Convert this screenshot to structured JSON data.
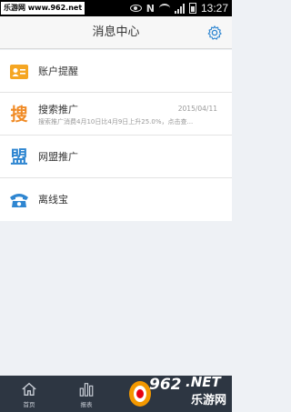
{
  "status_bar": {
    "watermark": "乐游网 www.962.net",
    "network_letter": "N",
    "time": "13:27"
  },
  "header": {
    "title": "消息中心"
  },
  "list": {
    "items": [
      {
        "title": "账户提醒",
        "icon": "account-alert-icon",
        "icon_color": "#f5a623"
      },
      {
        "title": "搜索推广",
        "icon": "search-promo-icon",
        "icon_char": "搜",
        "icon_color": "#f08a24",
        "date": "2015/04/11",
        "subtitle": "搜索推广消费4月10日比4月9日上升25.0%，点击查..."
      },
      {
        "title": "网盟推广",
        "icon": "network-alliance-icon",
        "icon_char": "盟",
        "icon_color": "#2f86d1"
      },
      {
        "title": "离线宝",
        "icon": "telephone-icon",
        "icon_color": "#2f86d1"
      }
    ]
  },
  "bottom_nav": {
    "home_label": "首页",
    "report_label": "报表"
  },
  "logo": {
    "number": "962",
    "net": ".NET",
    "text": "乐游网"
  },
  "colors": {
    "accent": "#2f86d1",
    "nav_bg": "#2d3642"
  }
}
